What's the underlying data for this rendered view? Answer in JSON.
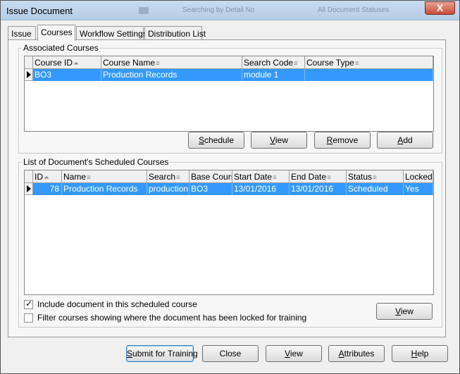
{
  "window": {
    "title": "Issue Document",
    "ghost_text_1": "Searching by Detail No",
    "ghost_text_2": "All Document Statuses",
    "close_label": "X"
  },
  "tabs": [
    {
      "label": "Issue",
      "active": false
    },
    {
      "label": "Courses",
      "active": true
    },
    {
      "label": "Workflow Settings",
      "active": false
    },
    {
      "label": "Distribution List",
      "active": false
    }
  ],
  "associated": {
    "label": "Associated Courses",
    "headers": [
      "Course ID",
      "Course Name",
      "Search Code",
      "Course Type"
    ],
    "rows": [
      [
        "BO3",
        "Production Records",
        "module 1",
        ""
      ]
    ],
    "buttons": {
      "schedule": {
        "label": "Schedule",
        "accel": "S",
        "rest": "chedule"
      },
      "view": {
        "label": "View",
        "accel": "V",
        "rest": "iew"
      },
      "remove": {
        "label": "Remove",
        "accel": "R",
        "rest": "emove"
      },
      "add": {
        "label": "Add",
        "accel": "A",
        "rest": "dd"
      }
    }
  },
  "scheduled": {
    "label": "List of Document's Scheduled Courses",
    "headers": [
      "ID",
      "Name",
      "Search",
      "Base Cours",
      "Start Date",
      "End Date",
      "Status",
      "Locked"
    ],
    "rows": [
      [
        "78",
        "Production Records",
        "production",
        "BO3",
        "13/01/2016",
        "13/01/2016",
        "Scheduled",
        "Yes"
      ]
    ],
    "include_checkbox": {
      "label": "Include document in this scheduled course",
      "checked": true
    },
    "filter_checkbox": {
      "label": "Filter courses showing where the document has been locked for training",
      "checked": false
    },
    "view_button": {
      "label": "View",
      "accel": "V",
      "rest": "iew"
    }
  },
  "footer": {
    "submit": {
      "label": "Submit for Training",
      "accel": "S",
      "rest": "ubmit for Training"
    },
    "close": {
      "label": "Close"
    },
    "view": {
      "label": "View",
      "accel": "V",
      "rest": "iew"
    },
    "attributes": {
      "label": "Attributes",
      "accel": "A",
      "rest": "ttributes"
    },
    "help": {
      "label": "Help",
      "accel": "H",
      "rest": "elp"
    }
  }
}
